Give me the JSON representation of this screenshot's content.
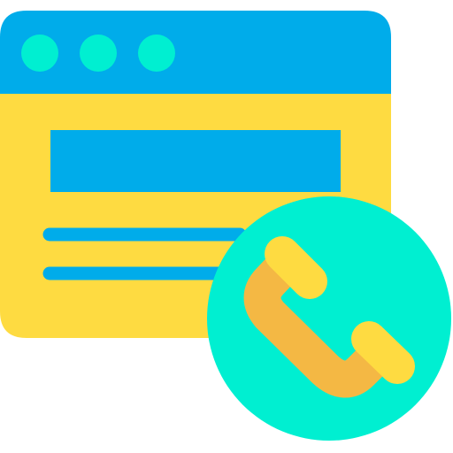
{
  "icon": {
    "name": "web-contact-icon",
    "parts": [
      "browser-window",
      "title-bar",
      "window-dots",
      "content-banner",
      "text-lines",
      "phone-badge",
      "phone-handset"
    ]
  },
  "colors": {
    "window_body": "#FEDB41",
    "title_bar": "#00ACEA",
    "dots": "#00EFD1",
    "banner": "#00ACEA",
    "text_lines": "#00ACEA",
    "badge_circle": "#00EFD1",
    "handset_body": "#F4B844",
    "handset_ends": "#FEDB41"
  }
}
